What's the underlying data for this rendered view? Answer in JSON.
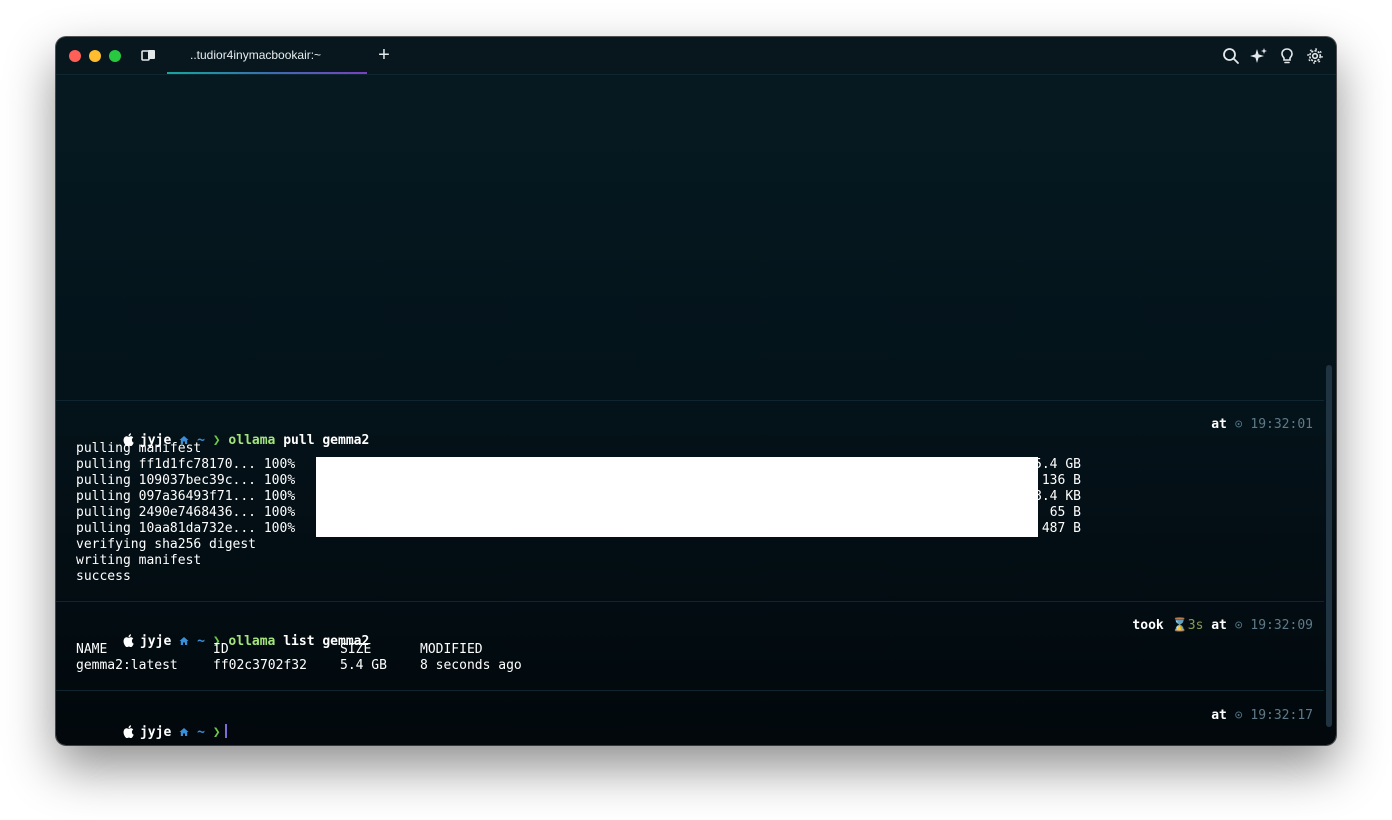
{
  "window": {
    "tab_title": "..tudior4inymacbookair:~",
    "new_tab_label": "+"
  },
  "icons": [
    "tabs-icon",
    "search-icon",
    "sparkle-icon",
    "lightbulb-icon",
    "gear-icon",
    "apple-icon",
    "home-icon",
    "clock-icon",
    "hourglass-icon"
  ],
  "colors": {
    "background": "#041219",
    "command": "#a4e57b",
    "prompt_chevron": "#6cc84b",
    "tilde": "#3a8fd8",
    "timestamp": "#5e7a88",
    "tab_underline_start": "#13a89a",
    "tab_underline_end": "#7d3fbf"
  },
  "blocks": [
    {
      "user": "jyje",
      "tilde": "~",
      "chevron": "❯",
      "command": "ollama",
      "args": "pull gemma2",
      "at_label": "at",
      "clock": "⊙",
      "time": "19:32:01",
      "output_header": "pulling manifest",
      "pull_rows": [
        {
          "text": "pulling ff1d1fc78170... 100%",
          "size": "5.4 GB"
        },
        {
          "text": "pulling 109037bec39c... 100%",
          "size": "136 B"
        },
        {
          "text": "pulling 097a36493f71... 100%",
          "size": "8.4 KB"
        },
        {
          "text": "pulling 2490e7468436... 100%",
          "size": "65 B"
        },
        {
          "text": "pulling 10aa81da732e... 100%",
          "size": "487 B"
        }
      ],
      "output_footer": [
        "verifying sha256 digest",
        "writing manifest",
        "success"
      ]
    },
    {
      "user": "jyje",
      "tilde": "~",
      "chevron": "❯",
      "command": "ollama",
      "args": "list gemma2",
      "took_label": "took",
      "hourglass": "⌛",
      "duration": "3s",
      "at_label": "at",
      "clock": "⊙",
      "time": "19:32:09",
      "table": {
        "headers": [
          "NAME",
          "ID",
          "SIZE",
          "MODIFIED"
        ],
        "rows": [
          [
            "gemma2:latest",
            "ff02c3702f32",
            "5.4 GB",
            "8 seconds ago"
          ]
        ]
      }
    },
    {
      "user": "jyje",
      "tilde": "~",
      "chevron": "❯",
      "at_label": "at",
      "clock": "⊙",
      "time": "19:32:17"
    }
  ]
}
